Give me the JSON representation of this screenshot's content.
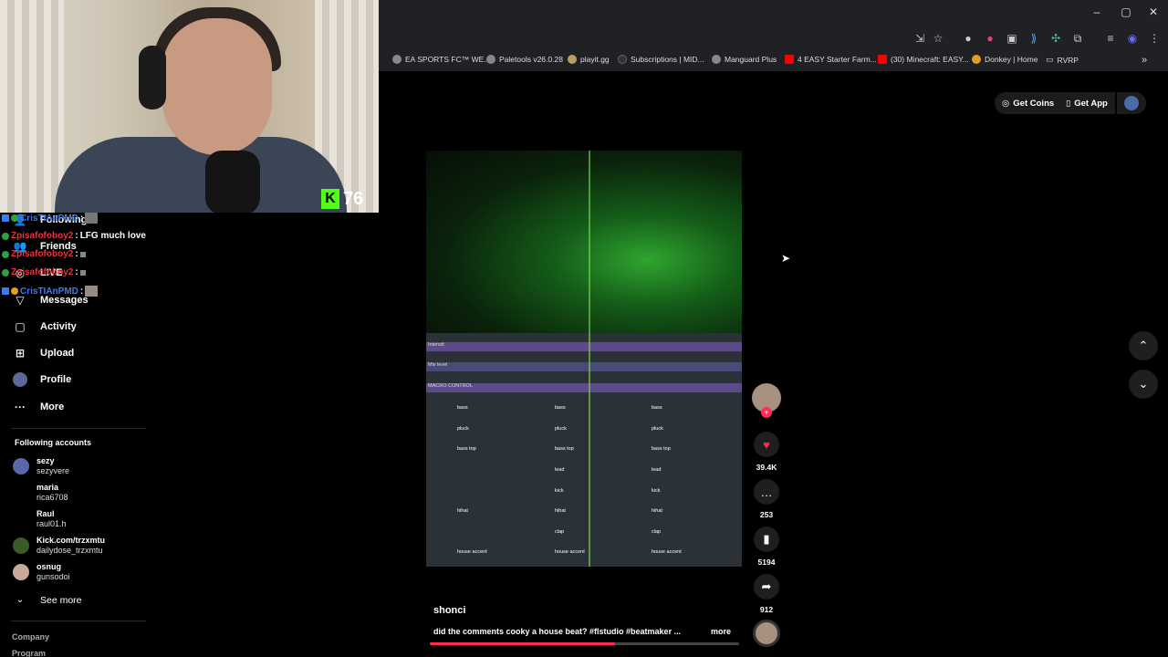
{
  "browser": {
    "window_controls": [
      "–",
      "▢",
      "✕"
    ],
    "bookmarks": [
      {
        "label": "EA SPORTS FC™ WE...",
        "color": "#888888"
      },
      {
        "label": "Paletools v26.0.28",
        "color": "#888888"
      },
      {
        "label": "playit.gg",
        "color": "#b8a060"
      },
      {
        "label": "Subscriptions | MID...",
        "color": "#333333"
      },
      {
        "label": "Manguard Plus",
        "color": "#888888"
      },
      {
        "label": "4 EASY Starter Farm...",
        "color": "#ff0000"
      },
      {
        "label": "(30) Minecraft: EASY...",
        "color": "#ff0000"
      },
      {
        "label": "Donkey | Home",
        "color": "#e0a020"
      },
      {
        "label": "RVRP",
        "color": "#888888"
      }
    ]
  },
  "stream": {
    "kick_logo": "K",
    "viewer_count": "76"
  },
  "chat": [
    {
      "user": "CrisTIAnPMD",
      "sep": ":",
      "msg": "",
      "color": "blue"
    },
    {
      "user": "Zpisafofoboy2",
      "sep": ":",
      "msg": "LFG much love",
      "color": "red"
    },
    {
      "user": "Zpisafofoboy2",
      "sep": ":",
      "msg": "",
      "color": "red"
    },
    {
      "user": "Zpisafofoboy2",
      "sep": ":",
      "msg": "",
      "color": "red"
    },
    {
      "user": "CrisTIAnPMD",
      "sep": ":",
      "msg": "",
      "color": "blue"
    }
  ],
  "sidebar": {
    "nav": [
      {
        "label": "Following",
        "icon": "following-icon"
      },
      {
        "label": "Friends",
        "icon": "friends-icon"
      },
      {
        "label": "LIVE",
        "icon": "live-icon"
      },
      {
        "label": "Messages",
        "icon": "messages-icon"
      },
      {
        "label": "Activity",
        "icon": "activity-icon"
      },
      {
        "label": "Upload",
        "icon": "upload-icon"
      },
      {
        "label": "Profile",
        "icon": "profile-icon"
      },
      {
        "label": "More",
        "icon": "more-icon"
      }
    ],
    "following_header": "Following accounts",
    "accounts": [
      {
        "name": "sezy",
        "handle": "sezyvere"
      },
      {
        "name": "maria",
        "handle": "rica6708"
      },
      {
        "name": "Raul",
        "handle": "raul01.h"
      },
      {
        "name": "Kick.com/trzxmtu",
        "handle": "dailydose_trzxmtu"
      },
      {
        "name": "osnug",
        "handle": "gunsodoi"
      }
    ],
    "see_more": "See more",
    "footer": [
      "Company",
      "Program"
    ]
  },
  "header": {
    "get_coins": "Get Coins",
    "get_app": "Get App"
  },
  "video": {
    "author": "shonci",
    "caption": "did the comments cooky a house beat? #flstudio #beatmaker ...",
    "more": "more",
    "progress": 0.6,
    "fl_tracks": [
      "Intensit",
      "Mix level",
      "MACRO CONTROL"
    ],
    "clips": [
      "bass",
      "pluck",
      "bass top",
      "lead",
      "kick",
      "hihat",
      "clap",
      "house accent"
    ]
  },
  "actions": {
    "likes": "39.4K",
    "comments": "253",
    "saves": "5194",
    "shares": "912"
  },
  "colors": {
    "like": "#fe2c55",
    "kick": "#53fc18",
    "progress": "#fe2c55"
  }
}
